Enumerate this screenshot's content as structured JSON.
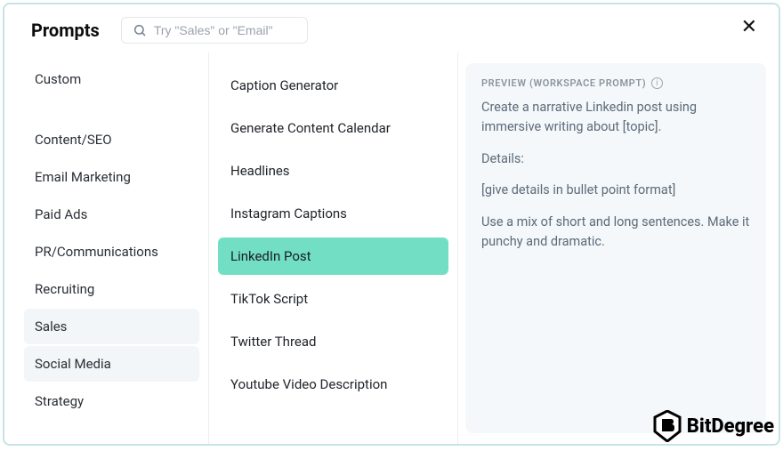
{
  "header": {
    "title": "Prompts",
    "search_placeholder": "Try \"Sales\" or \"Email\""
  },
  "sidebar": {
    "items": [
      {
        "label": "Custom",
        "selected": false
      },
      {
        "label": "Content/SEO",
        "selected": false
      },
      {
        "label": "Email Marketing",
        "selected": false
      },
      {
        "label": "Paid Ads",
        "selected": false
      },
      {
        "label": "PR/Communications",
        "selected": false
      },
      {
        "label": "Recruiting",
        "selected": false
      },
      {
        "label": "Sales",
        "selected": true
      },
      {
        "label": "Social Media",
        "selected": true
      },
      {
        "label": "Strategy",
        "selected": false
      }
    ]
  },
  "prompts": {
    "items": [
      {
        "label": "Caption Generator",
        "selected": false
      },
      {
        "label": "Generate Content Calendar",
        "selected": false
      },
      {
        "label": "Headlines",
        "selected": false
      },
      {
        "label": "Instagram Captions",
        "selected": false
      },
      {
        "label": "LinkedIn Post",
        "selected": true
      },
      {
        "label": "TikTok Script",
        "selected": false
      },
      {
        "label": "Twitter Thread",
        "selected": false
      },
      {
        "label": "Youtube Video Description",
        "selected": false
      }
    ]
  },
  "preview": {
    "label": "PREVIEW (WORKSPACE PROMPT)",
    "paragraphs": [
      "Create a narrative Linkedin post using immersive writing about [topic].",
      "Details:",
      "[give details in bullet point format]",
      "Use a mix of short and long sentences. Make it punchy and dramatic."
    ]
  },
  "watermark": {
    "label": "BitDegree"
  }
}
